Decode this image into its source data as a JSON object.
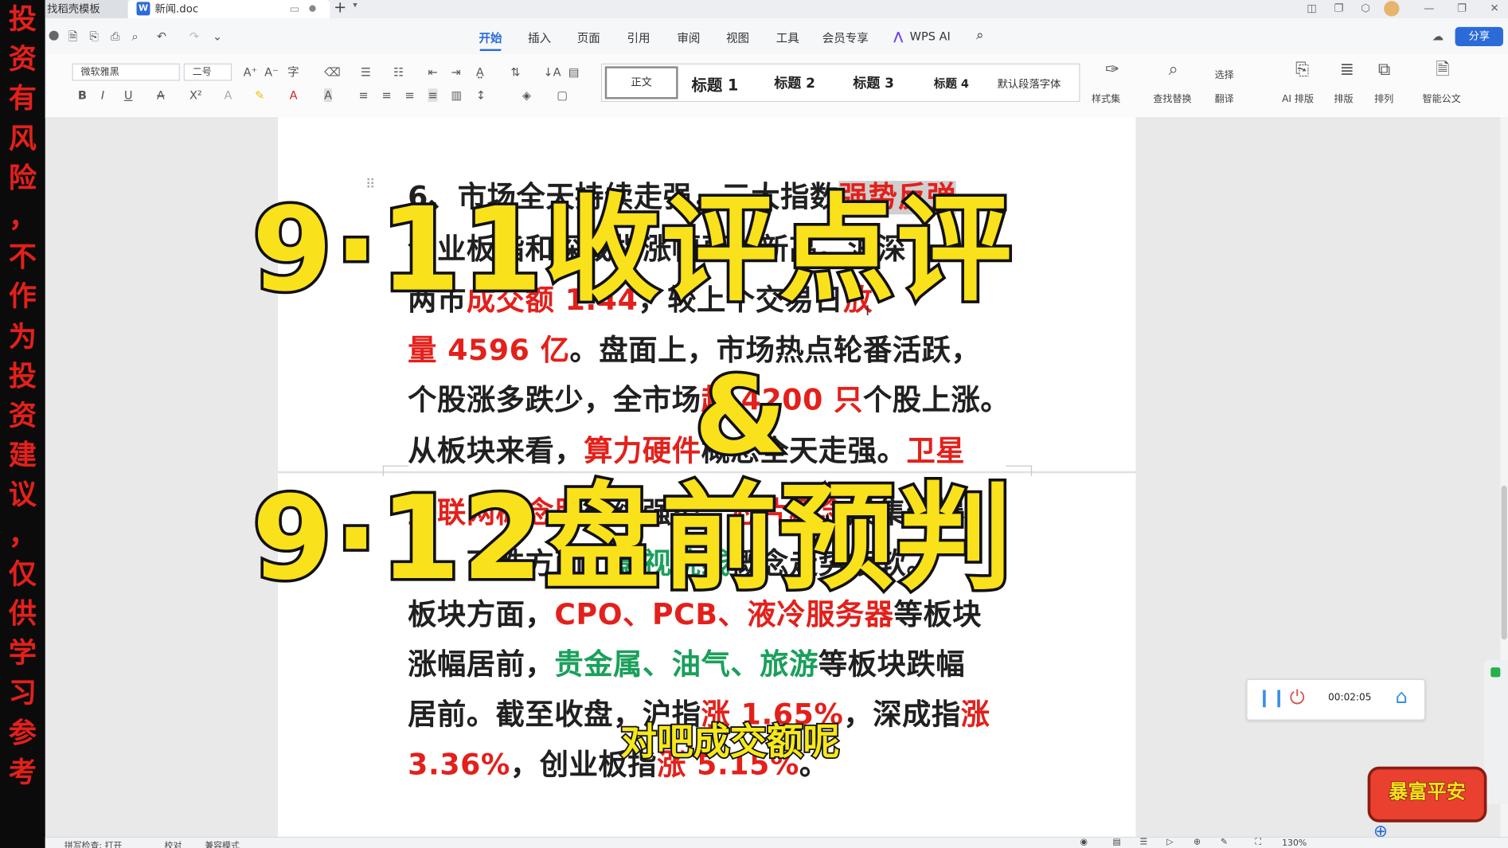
{
  "risk_banner": {
    "chars": [
      "投",
      "资",
      "有",
      "风",
      "险",
      "，",
      "不",
      "作",
      "为",
      "投",
      "资",
      "建",
      "议",
      "，",
      "仅",
      "供",
      "学",
      "习",
      "参",
      "考"
    ]
  },
  "tabs": {
    "tab1": "找稻壳模板",
    "tab2": "新闻.doc",
    "doc_icon_letter": "W",
    "new_tab": "+"
  },
  "menu": {
    "items": [
      "开始",
      "插入",
      "页面",
      "引用",
      "审阅",
      "视图",
      "工具",
      "会员专享",
      "WPS AI"
    ],
    "share": "分享"
  },
  "toolbar": {
    "font_name": "微软雅黑",
    "font_size": "二号",
    "styles": [
      "正文",
      "标题 1",
      "标题 2",
      "标题 3",
      "标题 4",
      "默认段落字体"
    ],
    "style_set": "样式集",
    "find_replace": "查找替换",
    "select": "选择",
    "translate": "翻译",
    "ai_layout": "AI 排版",
    "layout": "排版",
    "arrange": "排列",
    "smart_doc": "智能公文"
  },
  "document": {
    "l1a": "6、市场全天持续走强，三大指数",
    "l1b": "强势反弹",
    "l1c": "，",
    "l2": "创业板指和深成指涨幅再创新高。沪深",
    "l3a": "两市",
    "l3b": "成交额 1.44",
    "l3c": "，较上个交易日",
    "l3d": "放",
    "l4a": "量 4596 亿",
    "l4b": "。盘面上，市场热点轮番活跃，",
    "l5a": "个股涨多跌少，全市场",
    "l5b": "超 4200 只",
    "l5c": "个股上涨。",
    "l6a": "从板块来看，",
    "l6b": "算力硬件",
    "l6c": "概念全天走强。",
    "l6d": "卫星",
    "l7a": "互联网概念股",
    "l7b": "延续强势，",
    "l7c": "芯片概念",
    "l7d": "股集体爆",
    "l8a": "发。下跌方面，",
    "l8b": "影视院线",
    "l8c": "概念走势疲软。",
    "l9a": "板块方面，",
    "l9b": "CPO、PCB、液冷服务器",
    "l9c": "等板块",
    "l10a": "涨幅居前，",
    "l10b": "贵金属、油气、旅游",
    "l10c": "等板块跌幅",
    "l11a": "居前。截至收盘，沪指",
    "l11b": "涨 1.65%",
    "l11c": "，深成指",
    "l11d": "涨",
    "l12a": "3.36%",
    "l12b": "，创业板指",
    "l12c": "涨 5.15%",
    "l12d": "。"
  },
  "overlay": {
    "title1": "9·11收评点评",
    "amp": "&",
    "title2": "9·12盘前预判",
    "subtitle": "对吧成交额呢"
  },
  "timer": {
    "time": "00:02:05"
  },
  "statusbar": {
    "spell": "拼写检查: 打开",
    "proof": "校对",
    "compat": "兼容模式",
    "zoom": "130%"
  },
  "badge": {
    "text": "暴富平安"
  }
}
